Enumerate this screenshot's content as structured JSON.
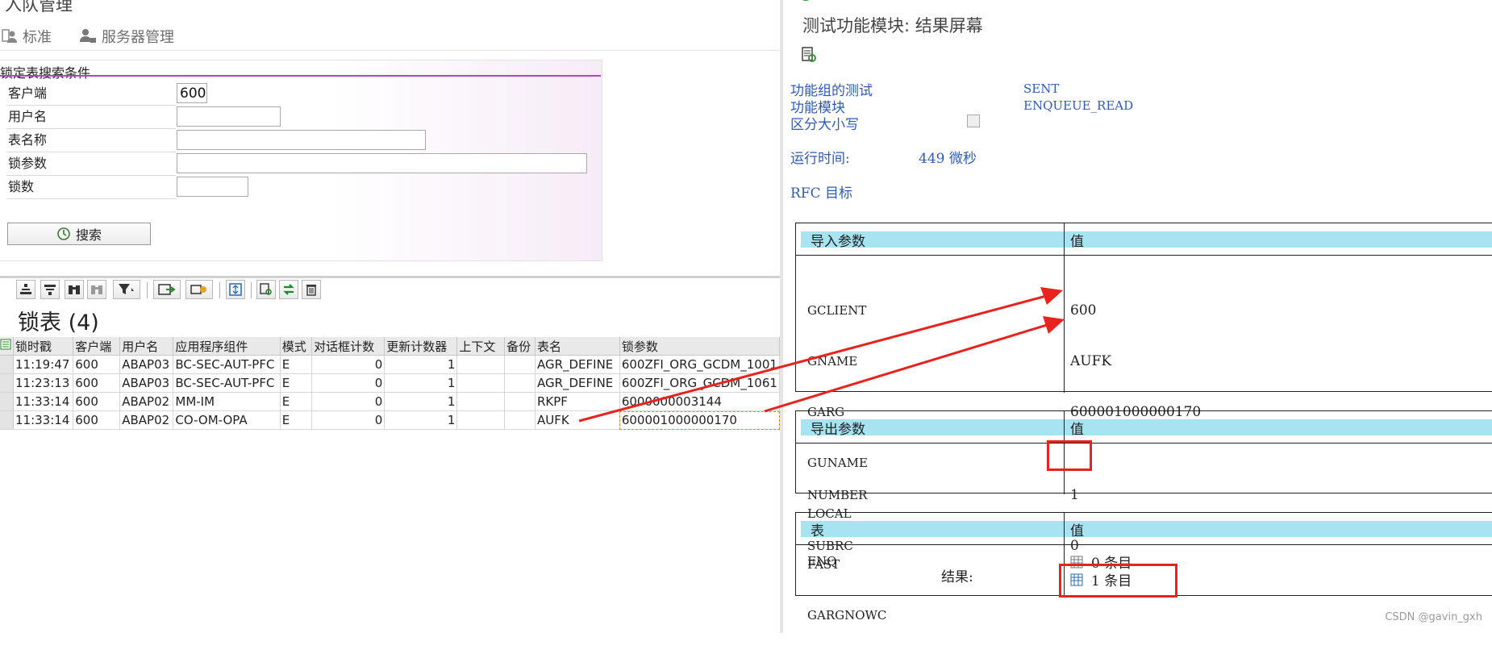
{
  "left": {
    "window_title": "入队管理",
    "toolbar": {
      "standard_label": "标准",
      "server_label": "服务器管理"
    },
    "search": {
      "title": "锁定表搜索条件",
      "client_label": "客户端",
      "client_value": "600",
      "user_label": "用户名",
      "user_value": "",
      "table_label": "表名称",
      "table_value": "",
      "arg_label": "锁参数",
      "arg_value": "",
      "count_label": "锁数",
      "count_value": "",
      "button_label": "搜索"
    },
    "table": {
      "title": "锁表 (4)",
      "columns": [
        "锁时戳",
        "客户端",
        "用户名",
        "应用程序组件",
        "模式",
        "对话框计数",
        "更新计数器",
        "上下文",
        "备份",
        "表名",
        "锁参数"
      ],
      "rows": [
        [
          "11:19:47",
          "600",
          "ABAP03",
          "BC-SEC-AUT-PFC",
          "E",
          "0",
          "1",
          "",
          "",
          "AGR_DEFINE",
          "600ZFI_ORG_GCDM_1001"
        ],
        [
          "11:23:13",
          "600",
          "ABAP03",
          "BC-SEC-AUT-PFC",
          "E",
          "0",
          "1",
          "",
          "",
          "AGR_DEFINE",
          "600ZFI_ORG_GCDM_1061"
        ],
        [
          "11:33:14",
          "600",
          "ABAP02",
          "MM-IM",
          "E",
          "0",
          "1",
          "",
          "",
          "RKPF",
          "6000000003144"
        ],
        [
          "11:33:14",
          "600",
          "ABAP02",
          "CO-OM-OPA",
          "E",
          "0",
          "1",
          "",
          "",
          "AUFK",
          "600001000000170"
        ]
      ]
    }
  },
  "right": {
    "title": "测试功能模块: 结果屏幕",
    "fg_label": "功能组的测试",
    "fg_value": "SENT",
    "fm_label": "功能模块",
    "fm_value": "ENQUEUE_READ",
    "case_label": "区分大小写",
    "runtime_label": "运行时间:",
    "runtime_value": "449 微秒",
    "rfc_label": "RFC 目标",
    "import": {
      "head_name": "导入参数",
      "head_value": "值",
      "params": [
        "GCLIENT",
        "GNAME",
        "GARG",
        "GUNAME",
        "LOCAL",
        "FAST",
        "GARGNOWC"
      ],
      "values": [
        "600",
        "AUFK",
        "600001000000170",
        "",
        "",
        "",
        ""
      ]
    },
    "export": {
      "head_name": "导出参数",
      "head_value": "值",
      "params": [
        "NUMBER",
        "SUBRC"
      ],
      "values": [
        "1",
        "0"
      ]
    },
    "tables": {
      "head_name": "表",
      "head_value": "值",
      "name": "ENQ",
      "entries_label": "0 条目",
      "result_label": "结果:",
      "result_entries": "1 条目"
    },
    "watermark": "CSDN @gavin_gxh"
  },
  "colors": {
    "accent_purple": "#b540c9",
    "header_cyan": "#a8e3f2",
    "annotation_red": "#e8231d",
    "label_blue": "#2f5bb7"
  }
}
